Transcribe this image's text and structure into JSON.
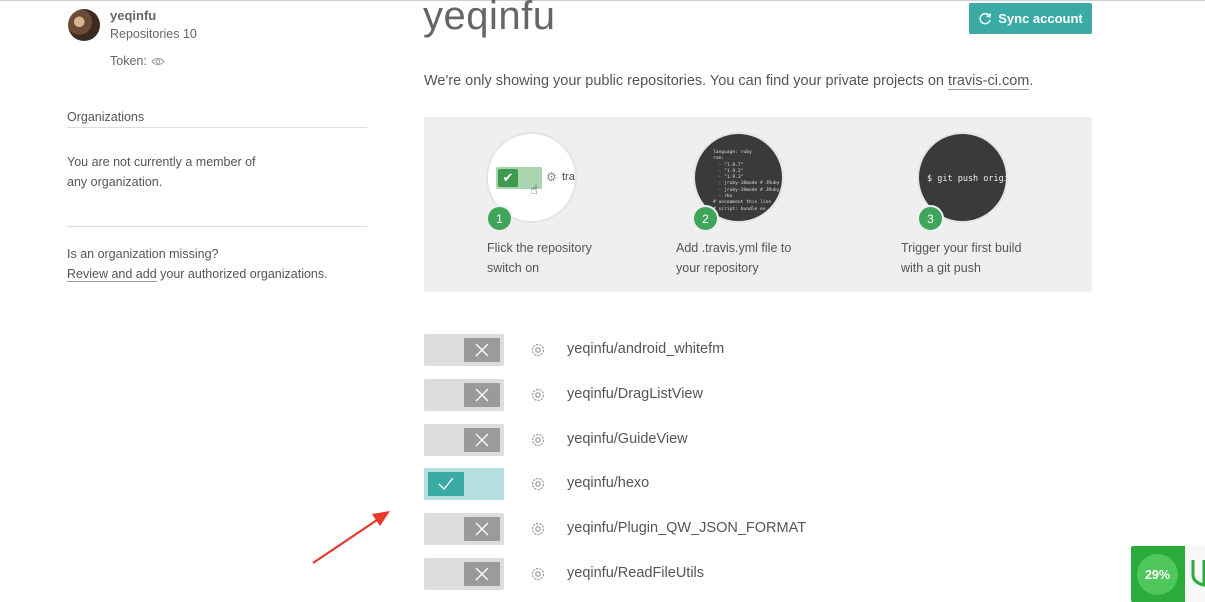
{
  "sidebar": {
    "username": "yeqinfu",
    "repositories": "Repositories 10",
    "token_label": "Token:",
    "organizations_title": "Organizations",
    "organizations_text": "You are not currently a member of any organization.",
    "missing_text": "Is an organization missing?",
    "review_link": "Review and add",
    "review_rest": " your authorized organizations."
  },
  "main": {
    "title": "yeqinfu",
    "sync_button": "Sync account",
    "info_prefix": "We're only showing your public repositories. You can find your private projects on ",
    "info_link": "travis-ci.com",
    "info_suffix": "."
  },
  "steps": [
    {
      "number": "1",
      "caption": "Flick the repository\nswitch on",
      "illustration_text": "tra"
    },
    {
      "number": "2",
      "caption": "Add .travis.yml file to\nyour repository",
      "illustration_text": "language: ruby\nrvm:\n  - \"1.8.7\"\n  - \"1.9.2\"\n  - \"1.9.3\"\n  - jruby-18mode # JRuby\n  - jruby-19mode # JRuby\n  - rbx\n# uncomment this line\n# script: bundle ex"
    },
    {
      "number": "3",
      "caption": "Trigger your first build\nwith a git push",
      "illustration_text": "$ git push origin"
    }
  ],
  "repos": [
    {
      "name": "yeqinfu/android_whitefm",
      "enabled": false
    },
    {
      "name": "yeqinfu/DragListView",
      "enabled": false
    },
    {
      "name": "yeqinfu/GuideView",
      "enabled": false
    },
    {
      "name": "yeqinfu/hexo",
      "enabled": true
    },
    {
      "name": "yeqinfu/Plugin_QW_JSON_FORMAT",
      "enabled": false
    },
    {
      "name": "yeqinfu/ReadFileUtils",
      "enabled": false
    }
  ],
  "widget": {
    "percent": "29%"
  },
  "colors": {
    "accent": "#39aaa4",
    "step_green": "#3fa55b",
    "arrow_red": "#e8372b",
    "widget_green": "#2bab3a"
  },
  "icons": [
    "eye-icon",
    "sync-icon",
    "gear-icon",
    "check-icon",
    "x-icon",
    "shield-icon"
  ]
}
